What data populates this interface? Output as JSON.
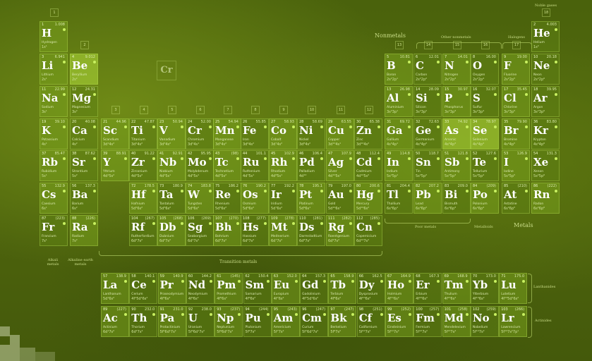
{
  "title": {
    "nonmetals": "Nonmetals",
    "other_nonmetals": "Other nonmetals",
    "halogens": "Halogens",
    "noble_gases": "Noble gases",
    "transition_metals": "Transition metals",
    "poor_metals": "Poor metals",
    "metalloids": "Metalloids",
    "metals": "Metals",
    "alkali_metals": "Alkali metals",
    "alkaline_earth_metals": "Alkaline earth metals",
    "lanthanides": "Lanthanides",
    "actinides": "Actinides"
  },
  "legend_symbol": "Cr",
  "colors": {
    "accent": "#c8f060",
    "cell": "#78a01e",
    "background": "#4a620c"
  },
  "elements": [
    {
      "n": "1",
      "s": "H",
      "name": "Hydrogen",
      "m": "1.008",
      "c": "1s¹",
      "g": 1,
      "p": 1
    },
    {
      "n": "2",
      "s": "He",
      "name": "Helium",
      "m": "4.003",
      "c": "1s²",
      "g": 18,
      "p": 1
    },
    {
      "n": "3",
      "s": "Li",
      "name": "Lithium",
      "m": "6.941",
      "c": "2s¹",
      "g": 1,
      "p": 2
    },
    {
      "n": "4",
      "s": "Be",
      "name": "Beryllium",
      "m": "9.012",
      "c": "2s²",
      "g": 2,
      "p": 2
    },
    {
      "n": "5",
      "s": "B",
      "name": "Boron",
      "m": "10.81",
      "c": "2s²2p¹",
      "g": 13,
      "p": 2
    },
    {
      "n": "6",
      "s": "C",
      "name": "Carbon",
      "m": "12.01",
      "c": "2s²2p²",
      "g": 14,
      "p": 2
    },
    {
      "n": "7",
      "s": "N",
      "name": "Nitrogen",
      "m": "14.01",
      "c": "2s²2p³",
      "g": 15,
      "p": 2
    },
    {
      "n": "8",
      "s": "O",
      "name": "Oxygen",
      "m": "16.00",
      "c": "2s²2p⁴",
      "g": 16,
      "p": 2
    },
    {
      "n": "9",
      "s": "F",
      "name": "Fluorine",
      "m": "19.00",
      "c": "2s²2p⁵",
      "g": 17,
      "p": 2
    },
    {
      "n": "10",
      "s": "Ne",
      "name": "Neon",
      "m": "20.18",
      "c": "2s²2p⁶",
      "g": 18,
      "p": 2
    },
    {
      "n": "11",
      "s": "Na",
      "name": "Sodium",
      "m": "22.99",
      "c": "3s¹",
      "g": 1,
      "p": 3
    },
    {
      "n": "12",
      "s": "Mg",
      "name": "Magnesium",
      "m": "24.31",
      "c": "3s²",
      "g": 2,
      "p": 3
    },
    {
      "n": "13",
      "s": "Al",
      "name": "Aluminium",
      "m": "26.98",
      "c": "3s²3p¹",
      "g": 13,
      "p": 3
    },
    {
      "n": "14",
      "s": "Si",
      "name": "Silicon",
      "m": "28.09",
      "c": "3s²3p²",
      "g": 14,
      "p": 3
    },
    {
      "n": "15",
      "s": "P",
      "name": "Phosphorus",
      "m": "30.97",
      "c": "3s²3p³",
      "g": 15,
      "p": 3
    },
    {
      "n": "16",
      "s": "S",
      "name": "Sulfur",
      "m": "32.07",
      "c": "3s²3p⁴",
      "g": 16,
      "p": 3
    },
    {
      "n": "17",
      "s": "Cl",
      "name": "Chlorine",
      "m": "35.45",
      "c": "3s²3p⁵",
      "g": 17,
      "p": 3
    },
    {
      "n": "18",
      "s": "Ar",
      "name": "Argon",
      "m": "39.95",
      "c": "3s²3p⁶",
      "g": 18,
      "p": 3
    },
    {
      "n": "19",
      "s": "K",
      "name": "Potassium",
      "m": "39.10",
      "c": "4s¹",
      "g": 1,
      "p": 4
    },
    {
      "n": "20",
      "s": "Ca",
      "name": "Calcium",
      "m": "40.08",
      "c": "4s²",
      "g": 2,
      "p": 4
    },
    {
      "n": "21",
      "s": "Sc",
      "name": "Scandium",
      "m": "44.96",
      "c": "3d¹4s²",
      "g": 3,
      "p": 4
    },
    {
      "n": "22",
      "s": "Ti",
      "name": "Titanium",
      "m": "47.87",
      "c": "3d²4s²",
      "g": 4,
      "p": 4
    },
    {
      "n": "23",
      "s": "V",
      "name": "Vanadium",
      "m": "50.94",
      "c": "3d³4s²",
      "g": 5,
      "p": 4
    },
    {
      "n": "24",
      "s": "Cr",
      "name": "Chromium",
      "m": "52.00",
      "c": "3d⁵4s¹",
      "g": 6,
      "p": 4
    },
    {
      "n": "25",
      "s": "Mn",
      "name": "Manganese",
      "m": "54.94",
      "c": "3d⁵4s²",
      "g": 7,
      "p": 4
    },
    {
      "n": "26",
      "s": "Fe",
      "name": "Iron",
      "m": "55.85",
      "c": "3d⁶4s²",
      "g": 8,
      "p": 4
    },
    {
      "n": "27",
      "s": "Co",
      "name": "Cobalt",
      "m": "58.93",
      "c": "3d⁷4s²",
      "g": 9,
      "p": 4
    },
    {
      "n": "28",
      "s": "Ni",
      "name": "Nickel",
      "m": "58.69",
      "c": "3d⁸4s²",
      "g": 10,
      "p": 4
    },
    {
      "n": "29",
      "s": "Cu",
      "name": "Copper",
      "m": "63.55",
      "c": "3d¹⁰4s¹",
      "g": 11,
      "p": 4
    },
    {
      "n": "30",
      "s": "Zn",
      "name": "Zinc",
      "m": "65.38",
      "c": "3d¹⁰4s²",
      "g": 12,
      "p": 4
    },
    {
      "n": "31",
      "s": "Ga",
      "name": "Gallium",
      "m": "69.72",
      "c": "4s²4p¹",
      "g": 13,
      "p": 4
    },
    {
      "n": "32",
      "s": "Ge",
      "name": "Germanium",
      "m": "72.63",
      "c": "4s²4p²",
      "g": 14,
      "p": 4
    },
    {
      "n": "33",
      "s": "As",
      "name": "Arsenic",
      "m": "74.92",
      "c": "4s²4p³",
      "g": 15,
      "p": 4
    },
    {
      "n": "34",
      "s": "Se",
      "name": "Selenium",
      "m": "78.97",
      "c": "4s²4p⁴",
      "g": 16,
      "p": 4
    },
    {
      "n": "35",
      "s": "Br",
      "name": "Bromine",
      "m": "79.90",
      "c": "4s²4p⁵",
      "g": 17,
      "p": 4
    },
    {
      "n": "36",
      "s": "Kr",
      "name": "Krypton",
      "m": "83.80",
      "c": "4s²4p⁶",
      "g": 18,
      "p": 4
    },
    {
      "n": "37",
      "s": "Rb",
      "name": "Rubidium",
      "m": "85.47",
      "c": "5s¹",
      "g": 1,
      "p": 5
    },
    {
      "n": "38",
      "s": "Sr",
      "name": "Strontium",
      "m": "87.62",
      "c": "5s²",
      "g": 2,
      "p": 5
    },
    {
      "n": "39",
      "s": "Y",
      "name": "Yttrium",
      "m": "88.91",
      "c": "4d¹5s²",
      "g": 3,
      "p": 5
    },
    {
      "n": "40",
      "s": "Zr",
      "name": "Zirconium",
      "m": "91.22",
      "c": "4d²5s²",
      "g": 4,
      "p": 5
    },
    {
      "n": "41",
      "s": "Nb",
      "name": "Niobium",
      "m": "92.91",
      "c": "4d⁴5s¹",
      "g": 5,
      "p": 5
    },
    {
      "n": "42",
      "s": "Mo",
      "name": "Molybdenum",
      "m": "95.95",
      "c": "4d⁵5s¹",
      "g": 6,
      "p": 5
    },
    {
      "n": "43",
      "s": "Tc",
      "name": "Technetium",
      "m": "(98)",
      "c": "4d⁵5s²",
      "g": 7,
      "p": 5
    },
    {
      "n": "44",
      "s": "Ru",
      "name": "Ruthenium",
      "m": "101.1",
      "c": "4d⁷5s¹",
      "g": 8,
      "p": 5
    },
    {
      "n": "45",
      "s": "Rh",
      "name": "Rhodium",
      "m": "102.9",
      "c": "4d⁸5s¹",
      "g": 9,
      "p": 5
    },
    {
      "n": "46",
      "s": "Pd",
      "name": "Palladium",
      "m": "106.4",
      "c": "4d¹⁰",
      "g": 10,
      "p": 5
    },
    {
      "n": "47",
      "s": "Ag",
      "name": "Silver",
      "m": "107.9",
      "c": "4d¹⁰5s¹",
      "g": 11,
      "p": 5
    },
    {
      "n": "48",
      "s": "Cd",
      "name": "Cadmium",
      "m": "112.4",
      "c": "4d¹⁰5s²",
      "g": 12,
      "p": 5
    },
    {
      "n": "49",
      "s": "In",
      "name": "Indium",
      "m": "114.8",
      "c": "5s²5p¹",
      "g": 13,
      "p": 5
    },
    {
      "n": "50",
      "s": "Sn",
      "name": "Tin",
      "m": "118.7",
      "c": "5s²5p²",
      "g": 14,
      "p": 5
    },
    {
      "n": "51",
      "s": "Sb",
      "name": "Antimony",
      "m": "121.8",
      "c": "5s²5p³",
      "g": 15,
      "p": 5
    },
    {
      "n": "52",
      "s": "Te",
      "name": "Tellurium",
      "m": "127.6",
      "c": "5s²5p⁴",
      "g": 16,
      "p": 5
    },
    {
      "n": "53",
      "s": "I",
      "name": "Iodine",
      "m": "126.9",
      "c": "5s²5p⁵",
      "g": 17,
      "p": 5
    },
    {
      "n": "54",
      "s": "Xe",
      "name": "Xenon",
      "m": "131.3",
      "c": "5s²5p⁶",
      "g": 18,
      "p": 5
    },
    {
      "n": "55",
      "s": "Cs",
      "name": "Caesium",
      "m": "132.9",
      "c": "6s¹",
      "g": 1,
      "p": 6
    },
    {
      "n": "56",
      "s": "Ba",
      "name": "Barium",
      "m": "137.3",
      "c": "6s²",
      "g": 2,
      "p": 6
    },
    {
      "n": "72",
      "s": "Hf",
      "name": "Hafnium",
      "m": "178.5",
      "c": "5d²6s²",
      "g": 4,
      "p": 6
    },
    {
      "n": "73",
      "s": "Ta",
      "name": "Tantalum",
      "m": "180.9",
      "c": "5d³6s²",
      "g": 5,
      "p": 6
    },
    {
      "n": "74",
      "s": "W",
      "name": "Tungsten",
      "m": "183.8",
      "c": "5d⁴6s²",
      "g": 6,
      "p": 6
    },
    {
      "n": "75",
      "s": "Re",
      "name": "Rhenium",
      "m": "186.2",
      "c": "5d⁵6s²",
      "g": 7,
      "p": 6
    },
    {
      "n": "76",
      "s": "Os",
      "name": "Osmium",
      "m": "190.2",
      "c": "5d⁶6s²",
      "g": 8,
      "p": 6
    },
    {
      "n": "77",
      "s": "Ir",
      "name": "Iridium",
      "m": "192.2",
      "c": "5d⁷6s²",
      "g": 9,
      "p": 6
    },
    {
      "n": "78",
      "s": "Pt",
      "name": "Platinum",
      "m": "195.1",
      "c": "5d⁹6s¹",
      "g": 10,
      "p": 6
    },
    {
      "n": "79",
      "s": "Au",
      "name": "Gold",
      "m": "197.0",
      "c": "5d¹⁰6s¹",
      "g": 11,
      "p": 6
    },
    {
      "n": "80",
      "s": "Hg",
      "name": "Mercury",
      "m": "200.6",
      "c": "5d¹⁰6s²",
      "g": 12,
      "p": 6
    },
    {
      "n": "81",
      "s": "Tl",
      "name": "Thallium",
      "m": "204.4",
      "c": "6s²6p¹",
      "g": 13,
      "p": 6
    },
    {
      "n": "82",
      "s": "Pb",
      "name": "Lead",
      "m": "207.2",
      "c": "6s²6p²",
      "g": 14,
      "p": 6
    },
    {
      "n": "83",
      "s": "Bi",
      "name": "Bismuth",
      "m": "209.0",
      "c": "6s²6p³",
      "g": 15,
      "p": 6
    },
    {
      "n": "84",
      "s": "Po",
      "name": "Polonium",
      "m": "(209)",
      "c": "6s²6p⁴",
      "g": 16,
      "p": 6
    },
    {
      "n": "85",
      "s": "At",
      "name": "Astatine",
      "m": "(210)",
      "c": "6s²6p⁵",
      "g": 17,
      "p": 6
    },
    {
      "n": "86",
      "s": "Rn",
      "name": "Radon",
      "m": "(222)",
      "c": "6s²6p⁶",
      "g": 18,
      "p": 6
    },
    {
      "n": "87",
      "s": "Fr",
      "name": "Francium",
      "m": "(223)",
      "c": "7s¹",
      "g": 1,
      "p": 7
    },
    {
      "n": "88",
      "s": "Ra",
      "name": "Radium",
      "m": "(226)",
      "c": "7s²",
      "g": 2,
      "p": 7
    },
    {
      "n": "104",
      "s": "Rf",
      "name": "Rutherfordium",
      "m": "(267)",
      "c": "6d²7s²",
      "g": 4,
      "p": 7
    },
    {
      "n": "105",
      "s": "Db",
      "name": "Dubnium",
      "m": "(268)",
      "c": "6d³7s²",
      "g": 5,
      "p": 7
    },
    {
      "n": "106",
      "s": "Sg",
      "name": "Seaborgium",
      "m": "(269)",
      "c": "6d⁴7s²",
      "g": 6,
      "p": 7
    },
    {
      "n": "107",
      "s": "Bh",
      "name": "Bohrium",
      "m": "(270)",
      "c": "6d⁵7s²",
      "g": 7,
      "p": 7
    },
    {
      "n": "108",
      "s": "Hs",
      "name": "Hassium",
      "m": "(277)",
      "c": "6d⁶7s²",
      "g": 8,
      "p": 7
    },
    {
      "n": "109",
      "s": "Mt",
      "name": "Meitnerium",
      "m": "(278)",
      "c": "6d⁷7s²",
      "g": 9,
      "p": 7
    },
    {
      "n": "110",
      "s": "Ds",
      "name": "Darmstadtium",
      "m": "(281)",
      "c": "6d⁸7s²",
      "g": 10,
      "p": 7
    },
    {
      "n": "111",
      "s": "Rg",
      "name": "Roentgenium",
      "m": "(282)",
      "c": "6d⁹7s²",
      "g": 11,
      "p": 7
    },
    {
      "n": "112",
      "s": "Cn",
      "name": "Copernicium",
      "m": "(285)",
      "c": "6d¹⁰7s²",
      "g": 12,
      "p": 7
    }
  ],
  "lanthanides": [
    {
      "n": "57",
      "s": "La",
      "name": "Lanthanum",
      "m": "138.9",
      "c": "5d¹6s²"
    },
    {
      "n": "58",
      "s": "Ce",
      "name": "Cerium",
      "m": "140.1",
      "c": "4f¹5d¹6s²"
    },
    {
      "n": "59",
      "s": "Pr",
      "name": "Praseodymium",
      "m": "140.9",
      "c": "4f³6s²"
    },
    {
      "n": "60",
      "s": "Nd",
      "name": "Neodymium",
      "m": "144.2",
      "c": "4f⁴6s²"
    },
    {
      "n": "61",
      "s": "Pm",
      "name": "Promethium",
      "m": "(145)",
      "c": "4f⁵6s²"
    },
    {
      "n": "62",
      "s": "Sm",
      "name": "Samarium",
      "m": "150.4",
      "c": "4f⁶6s²"
    },
    {
      "n": "63",
      "s": "Eu",
      "name": "Europium",
      "m": "152.0",
      "c": "4f⁷6s²"
    },
    {
      "n": "64",
      "s": "Gd",
      "name": "Gadolinium",
      "m": "157.3",
      "c": "4f⁷5d¹6s²"
    },
    {
      "n": "65",
      "s": "Tb",
      "name": "Terbium",
      "m": "158.9",
      "c": "4f⁹6s²"
    },
    {
      "n": "66",
      "s": "Dy",
      "name": "Dysprosium",
      "m": "162.5",
      "c": "4f¹⁰6s²"
    },
    {
      "n": "67",
      "s": "Ho",
      "name": "Holmium",
      "m": "164.9",
      "c": "4f¹¹6s²"
    },
    {
      "n": "68",
      "s": "Er",
      "name": "Erbium",
      "m": "167.3",
      "c": "4f¹²6s²"
    },
    {
      "n": "69",
      "s": "Tm",
      "name": "Thulium",
      "m": "168.9",
      "c": "4f¹³6s²"
    },
    {
      "n": "70",
      "s": "Yb",
      "name": "Ytterbium",
      "m": "173.0",
      "c": "4f¹⁴6s²"
    },
    {
      "n": "71",
      "s": "Lu",
      "name": "Lutetium",
      "m": "175.0",
      "c": "4f¹⁴5d¹6s²"
    }
  ],
  "actinides": [
    {
      "n": "89",
      "s": "Ac",
      "name": "Actinium",
      "m": "(227)",
      "c": "6d¹7s²"
    },
    {
      "n": "90",
      "s": "Th",
      "name": "Thorium",
      "m": "232.0",
      "c": "6d²7s²"
    },
    {
      "n": "91",
      "s": "Pa",
      "name": "Protactinium",
      "m": "231.0",
      "c": "5f²6d¹7s²"
    },
    {
      "n": "92",
      "s": "U",
      "name": "Uranium",
      "m": "238.0",
      "c": "5f³6d¹7s²"
    },
    {
      "n": "93",
      "s": "Np",
      "name": "Neptunium",
      "m": "(237)",
      "c": "5f⁴6d¹7s²"
    },
    {
      "n": "94",
      "s": "Pu",
      "name": "Plutonium",
      "m": "(244)",
      "c": "5f⁶7s²"
    },
    {
      "n": "95",
      "s": "Am",
      "name": "Americium",
      "m": "(243)",
      "c": "5f⁷7s²"
    },
    {
      "n": "96",
      "s": "Cm",
      "name": "Curium",
      "m": "(247)",
      "c": "5f⁷6d¹7s²"
    },
    {
      "n": "97",
      "s": "Bk",
      "name": "Berkelium",
      "m": "(247)",
      "c": "5f⁹7s²"
    },
    {
      "n": "98",
      "s": "Cf",
      "name": "Californium",
      "m": "(251)",
      "c": "5f¹⁰7s²"
    },
    {
      "n": "99",
      "s": "Es",
      "name": "Einsteinium",
      "m": "(252)",
      "c": "5f¹¹7s²"
    },
    {
      "n": "100",
      "s": "Fm",
      "name": "Fermium",
      "m": "(257)",
      "c": "5f¹²7s²"
    },
    {
      "n": "101",
      "s": "Md",
      "name": "Mendelevium",
      "m": "(258)",
      "c": "5f¹³7s²"
    },
    {
      "n": "102",
      "s": "No",
      "name": "Nobelium",
      "m": "(259)",
      "c": "5f¹⁴7s²"
    },
    {
      "n": "103",
      "s": "Lr",
      "name": "Lawrencium",
      "m": "(266)",
      "c": "5f¹⁴7s²7p¹"
    }
  ],
  "group_numbers": [
    "1",
    "2",
    "3",
    "4",
    "5",
    "6",
    "7",
    "8",
    "9",
    "10",
    "11",
    "12",
    "13",
    "14",
    "15",
    "16",
    "17",
    "18"
  ]
}
